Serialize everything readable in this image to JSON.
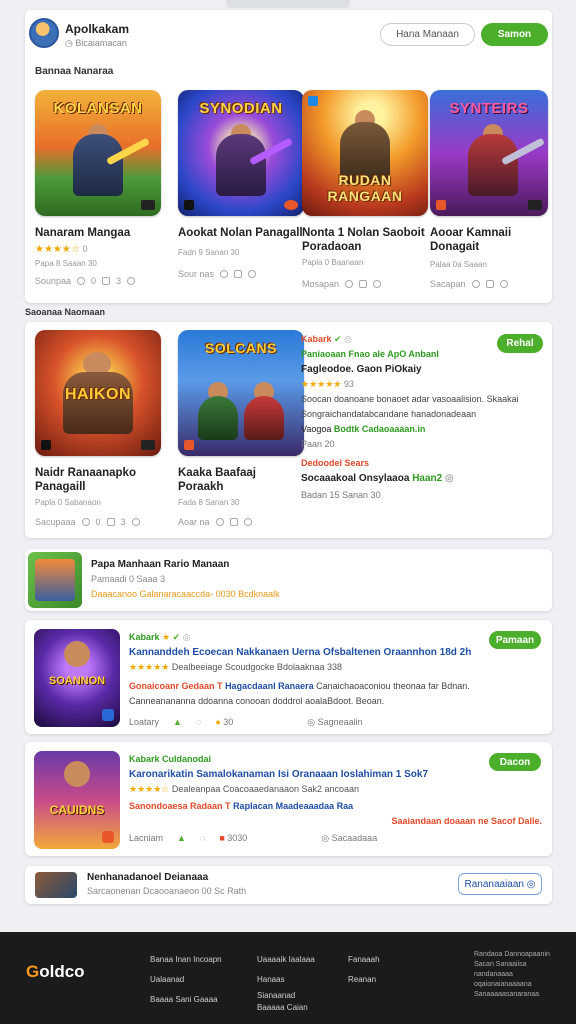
{
  "header": {
    "app_title": "Apolkakam",
    "app_sub": "Bicaiamacan",
    "outline_btn": "Hana Manaan",
    "green_btn": "Samon"
  },
  "section1": {
    "title": "Bannaa Nanaraa",
    "tiles": [
      {
        "art": "KOLANSAN",
        "name": "Nanaram Mangaa",
        "stars": "★★★★☆",
        "rating": "0",
        "meta": "Papa 8 Saaan 30",
        "actions": [
          "Sounpaa",
          "0",
          "3"
        ]
      },
      {
        "art": "SYNODIAN",
        "name": "Aookat Nolan Panagall",
        "stars": "",
        "rating": "",
        "meta": "Fadn 9 Sanan 30",
        "actions": [
          "Sour nas"
        ]
      },
      {
        "art": "RUDAN RANGAAN",
        "name": "Nonta 1 Nolan Saoboit Poradaoan",
        "stars": "",
        "rating": "",
        "meta": "Papla 0 Baanaan",
        "actions": [
          "Mosapan"
        ]
      },
      {
        "art": "SYNTEIRS",
        "name": "Aooar Kamnaii Donagait",
        "stars": "",
        "rating": "",
        "meta": "Palaa 0a Saaan",
        "actions": [
          "Sacapan"
        ]
      }
    ]
  },
  "section2": {
    "title": "Saoanaa Naomaan",
    "tiles": [
      {
        "art": "HAIKON",
        "name": "Naidr Ranaanapko Panagaill",
        "meta": "Papla 0 Sabanaon",
        "actions": [
          "Sacupaaa",
          "0",
          "3"
        ]
      },
      {
        "art": "SOLCANS",
        "name": "Kaaka Baafaaj Poraakh",
        "meta": "Fada 8 Sanan 30",
        "actions": [
          "Aoar na"
        ]
      }
    ],
    "info": {
      "title": "Kabark",
      "line1": "Paniaoaan  Fnao ale  ApO Anbanl",
      "line2": "Fagleodoe.  Gaon PiOkaiy",
      "stars": "★★★★★",
      "rating": "93",
      "desc1": "Soocan doanoane bonaoet adar vasoaalision. Skaakai",
      "desc2": "Songraichandatabcandane hanadonadeaan",
      "tag_line_a": "Vaogoa",
      "tag_line_b": "Bodtk  Cadaoaaaan.in",
      "line_meta": "Paan 20",
      "red_line": "Dedoodel Sears",
      "line_bold": "Socaaakoal Onsylaaoa",
      "line_bold_green": "Haan2",
      "last": "Badan 15 Sanan 30",
      "btn": "Rehal"
    }
  },
  "strip": {
    "title": "Papa Manhaan Rario Manaan",
    "sub": "Pamaadi 0 Saaa 3",
    "line": "Daaacanoo   Galanaracaaccda- 0030 Bcdknaalk"
  },
  "list": [
    {
      "art": "SOANNON",
      "title": "Kabark",
      "headline": "Kannanddeh  Ecoecan Nakkanaen Uerna Ofsbaltenen Oraannhon 18d 2h",
      "stars": "★★★★★",
      "line2": "Dealbeeiage Scoudgocke Bdolaaknaa 338",
      "red1": "Gonaicoanr Gedaan",
      "red2": "Hagacdaanl Ranaera",
      "tail": "Canaichaoaconiou theonaa far Bdnan.",
      "desc": "Canneanananna ddoanna conooan doddrol aoalaBdoot. Beoan.",
      "actions": [
        "Loatary",
        "30",
        "Sagneaalin"
      ],
      "btn": "Pamaan"
    },
    {
      "art": "CAUIDNS",
      "title": "Kabark  Culdanodai",
      "headline": "Karonarikatin  Samalokanaman Isi Oranaaan Ioslahiman 1 Sok7",
      "stars": "★★★★☆",
      "line2": "Dealeanpaa Coacoaaedanaaon Sak2  ancoaan",
      "red1": "Sanondoaesa Radaan",
      "red2": "Raplacan  Maadeaaadaa Raa",
      "tail": "Saaiandaan doaaan ne Sacof Dalle.",
      "desc": "",
      "actions": [
        "Lacniam",
        "3030",
        "Sacaadaaa"
      ],
      "btn": "Dacon"
    }
  ],
  "mini": {
    "title": "Nenhanadanoel Deianaaa",
    "sub": "Sarcaonenan Dcaooanaeon 00 Sc Rath",
    "btn": "Rananaaiaan"
  },
  "footer": {
    "logo_a": "G",
    "logo_b": "oldco",
    "col1": [
      "Banaa Inan Incoapn",
      "Ualaanad",
      "Baaaa Sani Gaaaa"
    ],
    "col2": [
      "Uaaaaik Iaalaaa",
      "Hanaas",
      "Sianaanad",
      "Baaaaa Caian"
    ],
    "col3": [
      "Fanaaah",
      "Reanan"
    ],
    "note": "Randaoa Dannoapaanin Sacan Sanaaiisa nandanaaaa oqaionaianaaaana Sanaaaaasanaranaa"
  },
  "colors": {
    "accent": "#4caf2b",
    "rating": "#f2a900",
    "link": "#1f4fa5",
    "alert": "#e44a2a"
  }
}
